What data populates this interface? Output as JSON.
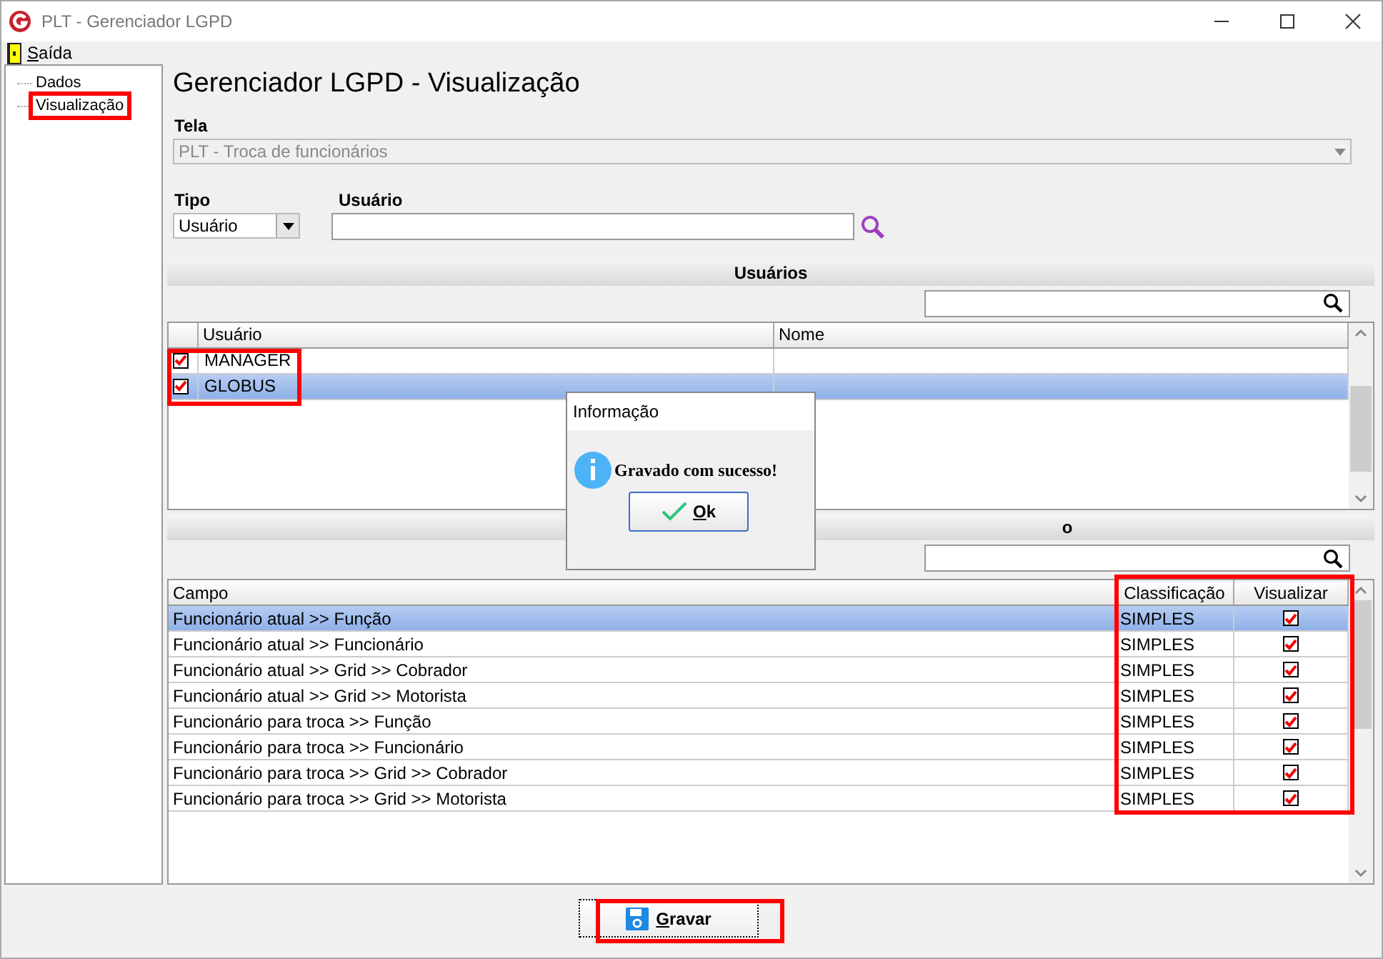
{
  "window": {
    "title": "PLT - Gerenciador LGPD"
  },
  "menu": [
    {
      "label": "Saída"
    }
  ],
  "tree": [
    {
      "label": "Dados",
      "selected": false
    },
    {
      "label": "Visualização",
      "selected": true
    }
  ],
  "heading": "Gerenciador LGPD - Visualização",
  "tela": {
    "label": "Tela",
    "value": "PLT - Troca de funcionários",
    "disabled": true
  },
  "tipo": {
    "label": "Tipo",
    "value": "Usuário"
  },
  "usuario": {
    "label": "Usuário"
  },
  "users_section": {
    "title": "Usuários",
    "columns": [
      "Usuário",
      "Nome"
    ],
    "rows": [
      {
        "usuario": "MANAGER",
        "checked": true,
        "selected": false
      },
      {
        "usuario": "GLOBUS",
        "checked": true,
        "selected": true
      }
    ]
  },
  "fields_section": {
    "title_visible": "o",
    "columns": [
      "Campo",
      "Classificação",
      "Visualizar"
    ],
    "rows": [
      {
        "campo": "Funcionário atual >> Função",
        "classificacao": "SIMPLES",
        "checked": true,
        "selected": true
      },
      {
        "campo": "Funcionário atual >> Funcionário",
        "classificacao": "SIMPLES",
        "checked": true,
        "selected": false
      },
      {
        "campo": "Funcionário atual >> Grid >> Cobrador",
        "classificacao": "SIMPLES",
        "checked": true,
        "selected": false
      },
      {
        "campo": "Funcionário atual >> Grid >> Motorista",
        "classificacao": "SIMPLES",
        "checked": true,
        "selected": false
      },
      {
        "campo": "Funcionário para troca >> Função",
        "classificacao": "SIMPLES",
        "checked": true,
        "selected": false
      },
      {
        "campo": "Funcionário para troca >> Funcionário",
        "classificacao": "SIMPLES",
        "checked": true,
        "selected": false
      },
      {
        "campo": "Funcionário para troca >> Grid >> Cobrador",
        "classificacao": "SIMPLES",
        "checked": true,
        "selected": false
      },
      {
        "campo": "Funcionário para troca >> Grid >> Motorista",
        "classificacao": "SIMPLES",
        "checked": true,
        "selected": false
      }
    ]
  },
  "save_button": "Gravar",
  "dialog": {
    "title": "Informação",
    "message": "Gravado com sucesso!",
    "button": "Ok"
  }
}
